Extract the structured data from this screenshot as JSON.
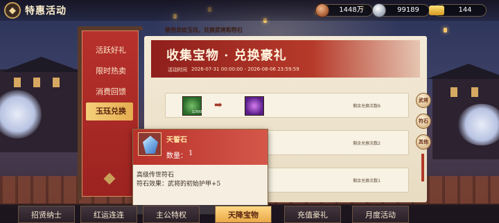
{
  "header": {
    "title": "特惠活动",
    "resources": [
      {
        "icon": "copper-coin-icon",
        "value": "1448万"
      },
      {
        "icon": "silver-coin-icon",
        "value": "99189"
      },
      {
        "icon": "gold-ingot-icon",
        "value": "144"
      }
    ]
  },
  "sidebar": {
    "tabs": [
      {
        "label": "活跃好礼",
        "active": false
      },
      {
        "label": "限时热卖",
        "active": false
      },
      {
        "label": "消费回馈",
        "active": false
      },
      {
        "label": "玉珏兑换",
        "active": true
      }
    ]
  },
  "event": {
    "subtitle": "使用龙纹玉珏，兑换武将和符石",
    "title": "收集宝物 · 兑换豪礼",
    "date_label": "活动时间",
    "date_range": "2026-07-31 00:00:00 - 2026-08-06 23:59:59",
    "rows": [
      {
        "cost_item": "dragon-jade-icon",
        "cost_qty": "1/300",
        "reward_item": "purple-general-icon",
        "remaining": "剩余兑换次数6"
      },
      {
        "remaining": "剩余兑换次数2"
      },
      {
        "remaining": "剩余兑换次数1"
      }
    ],
    "side_buttons": [
      "武将",
      "符石",
      "其他"
    ]
  },
  "tooltip": {
    "name": "天誓石",
    "qty_label": "数量：",
    "qty": "1",
    "desc1": "高级传世符石",
    "desc2": "符石效果：武将的初始护甲+5",
    "icon": "blue-gem-icon"
  },
  "bottom_tabs": [
    {
      "label": "招贤纳士",
      "active": false
    },
    {
      "label": "红运连连",
      "active": false
    },
    {
      "label": "主公特权",
      "active": false
    },
    {
      "label": "天降宝物",
      "active": true
    },
    {
      "label": "充值豪礼",
      "active": false
    },
    {
      "label": "月度活动",
      "active": false
    }
  ],
  "colors": {
    "accent_red": "#b63a2a",
    "gold": "#e9a847",
    "panel": "#f3ead7"
  }
}
